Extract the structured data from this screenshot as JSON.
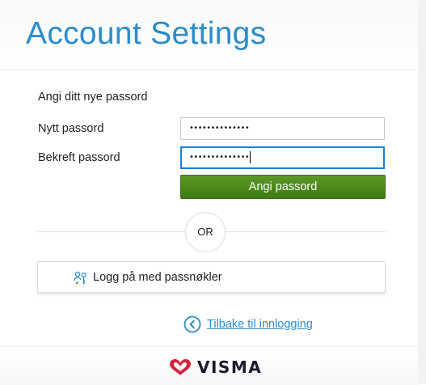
{
  "header": {
    "title": "Account Settings"
  },
  "form": {
    "instruction": "Angi ditt nye passord",
    "new_password": {
      "label": "Nytt passord",
      "value": "••••••••••••••"
    },
    "confirm_password": {
      "label": "Bekreft passord",
      "value": "••••••••••••••"
    },
    "submit_label": "Angi passord"
  },
  "separator": {
    "or_label": "OR"
  },
  "passkey": {
    "label": "Logg på med passnøkler",
    "icon": "passkey-icon"
  },
  "back_link": {
    "label": "Tilbake til innlogging",
    "icon": "chevron-left-circle-icon"
  },
  "footer": {
    "brand": "VISMA"
  },
  "colors": {
    "accent": "#2a8ccb",
    "submit_green": "#4a8a1c",
    "focus_border": "#1e7fcf",
    "brand_red": "#d1253c"
  }
}
